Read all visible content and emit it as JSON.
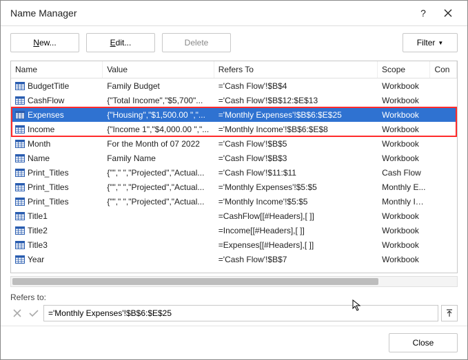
{
  "title": "Name Manager",
  "toolbar": {
    "new_label": "New...",
    "edit_label": "Edit...",
    "delete_label": "Delete",
    "filter_label": "Filter"
  },
  "columns": {
    "name": "Name",
    "value": "Value",
    "refers": "Refers To",
    "scope": "Scope",
    "comment": "Con"
  },
  "rows": [
    {
      "name": "BudgetTitle",
      "value": "Family Budget",
      "refers": "='Cash Flow'!$B$4",
      "scope": "Workbook",
      "sel": "",
      "h": ""
    },
    {
      "name": "CashFlow",
      "value": "{\"Total Income\",\"$5,700\"...",
      "refers": "='Cash Flow'!$B$12:$E$13",
      "scope": "Workbook",
      "sel": "",
      "h": ""
    },
    {
      "name": "Expenses",
      "value": "{\"Housing\",\"$1,500.00 \",\"...",
      "refers": "='Monthly Expenses'!$B$6:$E$25",
      "scope": "Workbook",
      "sel": "prim",
      "h": "y"
    },
    {
      "name": "Income",
      "value": "{\"Income 1\",\"$4,000.00 \",\"...",
      "refers": "='Monthly Income'!$B$6:$E$8",
      "scope": "Workbook",
      "sel": "",
      "h": "y"
    },
    {
      "name": "Month",
      "value": " For the Month of 07 2022",
      "refers": "='Cash Flow'!$B$5",
      "scope": "Workbook",
      "sel": "",
      "h": ""
    },
    {
      "name": "Name",
      "value": " Family Name",
      "refers": "='Cash Flow'!$B$3",
      "scope": "Workbook",
      "sel": "",
      "h": ""
    },
    {
      "name": "Print_Titles",
      "value": "{\"\",\" \",\"Projected\",\"Actual...",
      "refers": "='Cash Flow'!$11:$11",
      "scope": "Cash Flow",
      "sel": "",
      "h": ""
    },
    {
      "name": "Print_Titles",
      "value": "{\"\",\" \",\"Projected\",\"Actual...",
      "refers": "='Monthly Expenses'!$5:$5",
      "scope": "Monthly E...",
      "sel": "",
      "h": ""
    },
    {
      "name": "Print_Titles",
      "value": "{\"\",\" \",\"Projected\",\"Actual...",
      "refers": "='Monthly Income'!$5:$5",
      "scope": "Monthly In...",
      "sel": "",
      "h": ""
    },
    {
      "name": "Title1",
      "value": "",
      "refers": "=CashFlow[[#Headers],[ ]]",
      "scope": "Workbook",
      "sel": "",
      "h": ""
    },
    {
      "name": "Title2",
      "value": "",
      "refers": "=Income[[#Headers],[ ]]",
      "scope": "Workbook",
      "sel": "",
      "h": ""
    },
    {
      "name": "Title3",
      "value": "",
      "refers": "=Expenses[[#Headers],[ ]]",
      "scope": "Workbook",
      "sel": "",
      "h": ""
    },
    {
      "name": "Year",
      "value": "",
      "refers": "='Cash Flow'!$B$7",
      "scope": "Workbook",
      "sel": "",
      "h": ""
    }
  ],
  "refers_label": "Refers to:",
  "refers_value": "='Monthly Expenses'!$B$6:$E$25",
  "close_label": "Close"
}
